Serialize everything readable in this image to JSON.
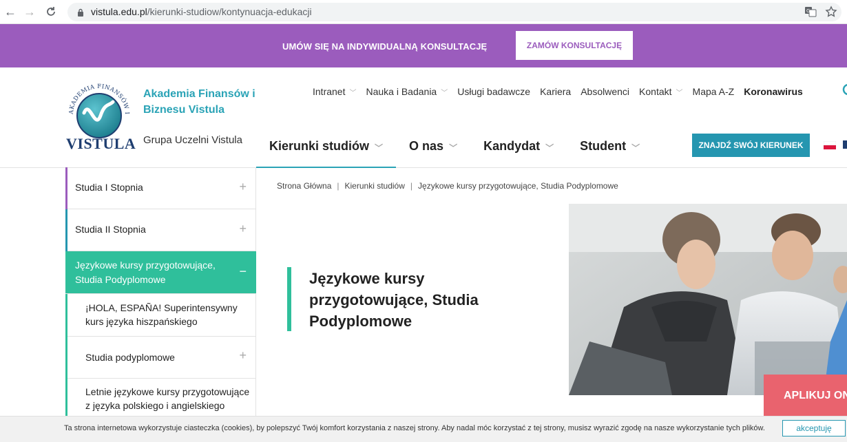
{
  "browser": {
    "url_domain": "vistula.edu.pl",
    "url_path": "/kierunki-studiow/kontynuacja-edukacji"
  },
  "consult_bar": {
    "text": "UMÓW SIĘ NA INDYWIDUALNĄ KONSULTACJĘ",
    "button": "ZAMÓW KONSULTACJĘ",
    "color": "#9b5cbd"
  },
  "header": {
    "logo_word": "VISTULA",
    "logo_ring_text": "AKADEMIA FINANSÓW I BIZNESU",
    "org_name": "Akademia Finansów i Biznesu Vistula",
    "org_group": "Grupa Uczelni Vistula",
    "top_nav": [
      {
        "label": "Intranet",
        "dropdown": true
      },
      {
        "label": "Nauka i Badania",
        "dropdown": true
      },
      {
        "label": "Usługi badawcze",
        "dropdown": false
      },
      {
        "label": "Kariera",
        "dropdown": false
      },
      {
        "label": "Absolwenci",
        "dropdown": false
      },
      {
        "label": "Kontakt",
        "dropdown": true
      },
      {
        "label": "Mapa A-Z",
        "dropdown": false
      },
      {
        "label": "Koronawirus",
        "dropdown": false
      }
    ],
    "main_nav": [
      {
        "label": "Kierunki studiów",
        "active": true
      },
      {
        "label": "O nas",
        "active": false
      },
      {
        "label": "Kandydat",
        "active": false
      },
      {
        "label": "Student",
        "active": false
      }
    ],
    "find_button": "ZNAJDŹ SWÓJ KIERUNEK",
    "accent": "#2596b0"
  },
  "sidebar": {
    "items": [
      {
        "label": "Studia I Stopnia",
        "expanded": false,
        "accent": "#9b5cbd"
      },
      {
        "label": "Studia II Stopnia",
        "expanded": false,
        "accent": "#2596b0"
      },
      {
        "label": "Językowe kursy przygotowujące, Studia Podyplomowe",
        "expanded": true,
        "accent": "#2fbf9b"
      }
    ],
    "sub_items": [
      {
        "label": "¡HOLA, ESPAÑA! Superintensywny kurs języka hiszpańskiego",
        "expandable": false
      },
      {
        "label": "Studia podyplomowe",
        "expandable": true
      },
      {
        "label": "Letnie językowe kursy przygotowujące z języka polskiego i angielskiego",
        "expandable": false
      }
    ]
  },
  "breadcrumb": [
    "Strona Główna",
    "Kierunki studiów",
    "Językowe kursy przygotowujące, Studia Podyplomowe"
  ],
  "hero": {
    "title": "Językowe kursy przygotowujące, Studia Podyplomowe",
    "accent": "#2fbf9b"
  },
  "apply_button": "APLIKUJ ON",
  "cookie": {
    "text": "Ta strona internetowa wykorzystuje ciasteczka (cookies), by polepszyć Twój komfort korzystania z naszej strony. Aby nadal móc korzystać z tej strony, musisz wyrazić zgodę na nasze wykorzystanie tych plików.",
    "button": "akceptuję"
  }
}
